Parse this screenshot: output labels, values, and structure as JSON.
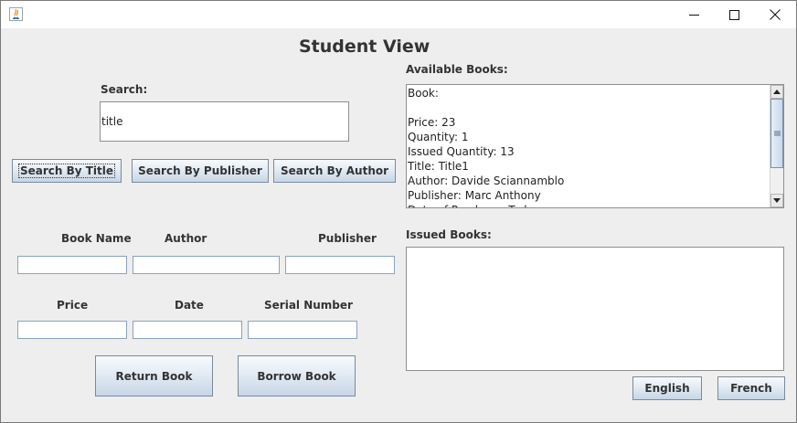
{
  "window": {
    "title": "",
    "minimize_icon": "minimize-icon",
    "maximize_icon": "maximize-icon",
    "close_icon": "close-icon"
  },
  "header": {
    "title": "Student View"
  },
  "search": {
    "label": "Search:",
    "value": "title",
    "buttons": {
      "by_title": "Search By Title",
      "by_publisher": "Search By Publisher",
      "by_author": "Search By Author"
    }
  },
  "form": {
    "book_name_label": "Book Name",
    "author_label": "Author",
    "publisher_label": "Publisher",
    "price_label": "Price",
    "date_label": "Date",
    "serial_number_label": "Serial Number",
    "book_name_value": "",
    "author_value": "",
    "publisher_value": "",
    "price_value": "",
    "date_value": "",
    "serial_number_value": ""
  },
  "actions": {
    "return_label": "Return Book",
    "borrow_label": "Borrow Book"
  },
  "available": {
    "label": "Available Books:",
    "lines": [
      "Book:",
      "",
      "Price: 23",
      "Quantity: 1",
      "Issued Quantity: 13",
      "Title: Title1",
      "Author: Davide Sciannamblo",
      "Publisher: Marc Anthony",
      "Date of Purchase: Today"
    ]
  },
  "issued": {
    "label": "Issued Books:",
    "content": ""
  },
  "language": {
    "english_label": "English",
    "french_label": "French"
  }
}
